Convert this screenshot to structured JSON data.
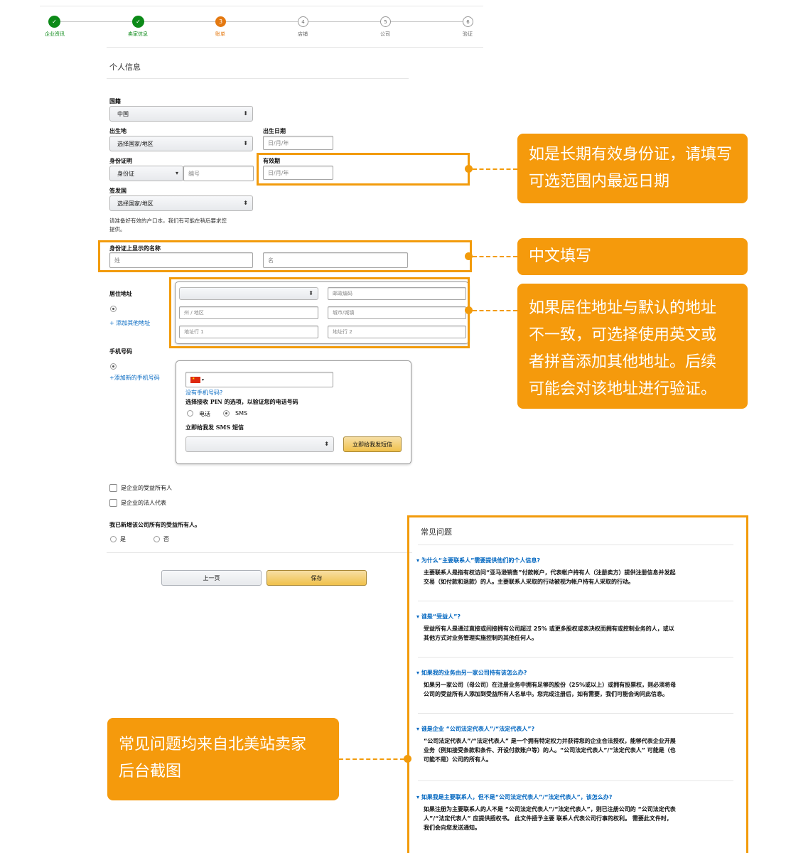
{
  "stepper": {
    "steps": [
      {
        "label": "企业资讯",
        "marker": "✓",
        "state": "done"
      },
      {
        "label": "卖家信息",
        "marker": "✓",
        "state": "done"
      },
      {
        "label": "账单",
        "marker": "3",
        "state": "current"
      },
      {
        "label": "店铺",
        "marker": "4",
        "state": "todo"
      },
      {
        "label": "公司",
        "marker": "5",
        "state": "todo"
      },
      {
        "label": "验证",
        "marker": "6",
        "state": "todo"
      }
    ]
  },
  "form": {
    "section_title": "个人信息",
    "country_label": "国籍",
    "country_value": "中国",
    "birthplace_label": "出生地",
    "birthplace_value": "选择国家/地区",
    "birthdate_label": "出生日期",
    "birthdate_placeholder": "日/月/年",
    "id_label": "身份证明",
    "id_type_value": "身份证",
    "id_number_placeholder": "编号",
    "expiry_label": "有效期",
    "expiry_placeholder": "日/月/年",
    "issuing_label": "签发国",
    "issuing_value": "选择国家/地区",
    "hukou_note_1": "请准备好有效的户口本，我们有可能在稍后要求您",
    "hukou_note_2": "提供。",
    "name_label": "身份证上显示的名称",
    "surname_placeholder": "姓",
    "given_placeholder": "名",
    "address_label": "居住地址",
    "add_address_link": "+ 添加其他地址",
    "postal_placeholder": "邮政编码",
    "state_placeholder": "州 / 地区",
    "city_placeholder": "城市/城镇",
    "addr1_placeholder": "地址行 1",
    "addr2_placeholder": "地址行 2",
    "phone_label": "手机号码",
    "add_phone_link": "+添加新的手机号码",
    "no_phone_link": "没有手机号码?",
    "pin_label": "选择接收 PIN 的选项，以验证您的电话号码",
    "pin_option_phone": "电话",
    "pin_option_sms": "SMS",
    "sms_label": "立即给我发 SMS 短信",
    "sms_button": "立即给我发短信",
    "beneficial_owner_checkbox": "是企业的受益所有人",
    "legal_rep_checkbox": "是企业的法人代表",
    "added_all_label": "我已新增该公司所有的受益所有人。",
    "yes_option": "是",
    "no_option": "否",
    "prev_button": "上一页",
    "save_button": "保存"
  },
  "callouts": {
    "expiry": [
      "如是长期有效身份证，请填写",
      "可选范围内最远日期"
    ],
    "name": [
      "中文填写"
    ],
    "address": [
      "如果居住地址与默认的地址",
      "不一致，可选择使用英文或",
      "者拼音添加其他地址。后续",
      "可能会对该地址进行验证。"
    ],
    "faq": [
      "常见问题均来自北美站卖家",
      "后台截图"
    ]
  },
  "faq": {
    "title": "常见问题",
    "items": [
      {
        "q": "为什么“主要联系人”需要提供他们的个人信息?",
        "a": [
          "主要联系人是指有权访问“亚马逊销售”付款帐户，代表帐户持有人（注册卖方）提供注册信息并发起",
          "交易（如付款和退款）的人。主要联系人采取的行动被视为帐户持有人采取的行动。"
        ]
      },
      {
        "q": "谁是“受益人”?",
        "a": [
          "受益所有人是通过直接或间接拥有公司超过 25% 或更多股权或表决权而拥有或控制业务的人，或以",
          "其他方式对业务管理实施控制的其他任何人。"
        ]
      },
      {
        "q": "如果我的业务由另一家公司持有该怎么办?",
        "a": [
          "如果另一家公司（母公司）在注册业务中拥有足够的股份（25%或以上）或拥有投票权，则必须将母",
          "公司的受益所有人添加到受益所有人名单中。您完成注册后，如有需要，我们可能会询问此信息。"
        ]
      },
      {
        "q": "谁是企业 “公司法定代表人”/“法定代表人”?",
        "a": [
          "“公司法定代表人”/“法定代表人” 是一个拥有特定权力并获得您的企业合法授权，能够代表企业开展",
          "业务（例如接受条款和条件、开设付款账户等）的人。“公司法定代表人”/“法定代表人” 可能是（也",
          "可能不是）公司的所有人。"
        ]
      },
      {
        "q": "如果我是主要联系人，但不是“公司法定代表人”/“法定代表人”，该怎么办?",
        "a": [
          "如果注册为主要联系人的人不是 “公司法定代表人”/“法定代表人”，则已注册公司的 “公司法定代表",
          "人”/“法定代表人” 应提供授权书。 此文件授予主要 联系人代表公司行事的权利。 需要此文件时，",
          "我们会向您发送通知。"
        ]
      }
    ]
  },
  "colors": {
    "accent": "#f59a0c",
    "done": "#0c8a18",
    "current": "#e47911",
    "link": "#0066c0"
  }
}
